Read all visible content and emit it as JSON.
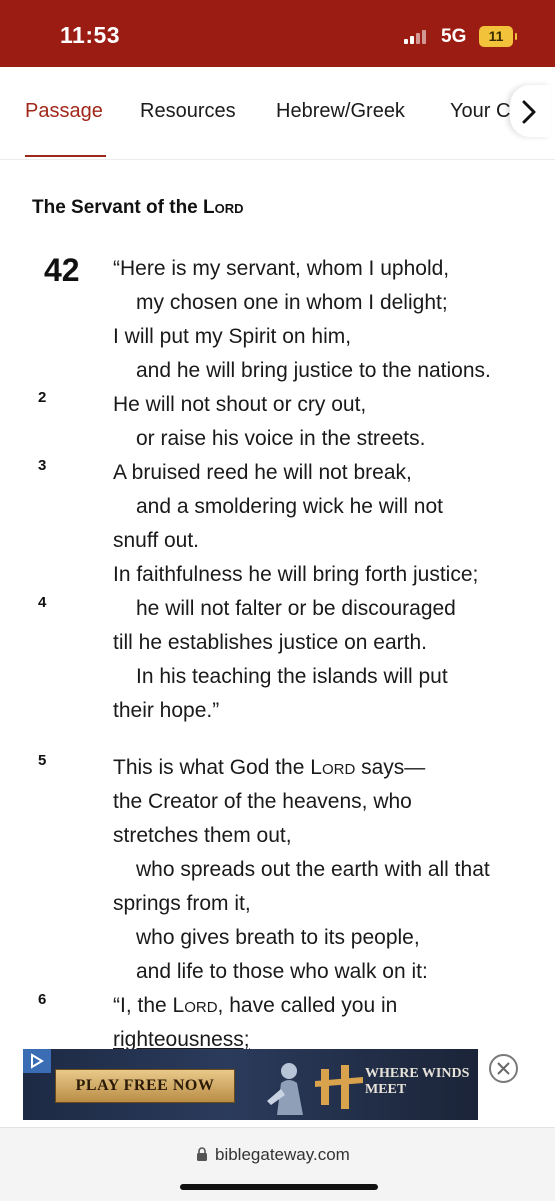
{
  "status": {
    "time": "11:53",
    "network": "5G",
    "battery": "11"
  },
  "tabs": {
    "items": [
      "Passage",
      "Resources",
      "Hebrew/Greek",
      "Your C"
    ],
    "active": "Passage"
  },
  "passage": {
    "heading_pre": "The Servant of the ",
    "heading_lord": "Lord",
    "chapter": "42",
    "verse_numbers": [
      "2",
      "3",
      "4",
      "5",
      "6"
    ],
    "lines": [
      "“Here is my servant, whom I uphold,",
      "my chosen one in whom I delight;",
      "I will put my Spirit on him,",
      "and he will bring justice to the nations.",
      "He will not shout or cry out,",
      "or raise his voice in the streets.",
      "A bruised reed he will not break,",
      "and a smoldering wick he will not",
      "snuff out.",
      "In faithfulness he will bring forth justice;",
      "he will not falter or be discouraged",
      "till he establishes justice on earth.",
      "In his teaching the islands will put",
      "their hope.”",
      "the Creator of the heavens, who",
      "stretches them out,",
      "who spreads out the earth with all that",
      "springs from it,",
      "who gives breath to its people,",
      "and life to those who walk on it:",
      "righteousness;"
    ],
    "v5_pre": "This is what God the ",
    "v5_lord": "Lord",
    "v5_post": " says—",
    "v6_pre": "“I, the ",
    "v6_lord": "Lord",
    "v6_post": ", have called you in"
  },
  "ad": {
    "cta": "PLAY FREE NOW",
    "title": "WHERE WINDS MEET"
  },
  "browser": {
    "url": "biblegateway.com"
  },
  "colors": {
    "status_bar": "#9b1c12",
    "accent": "#a0281b"
  }
}
